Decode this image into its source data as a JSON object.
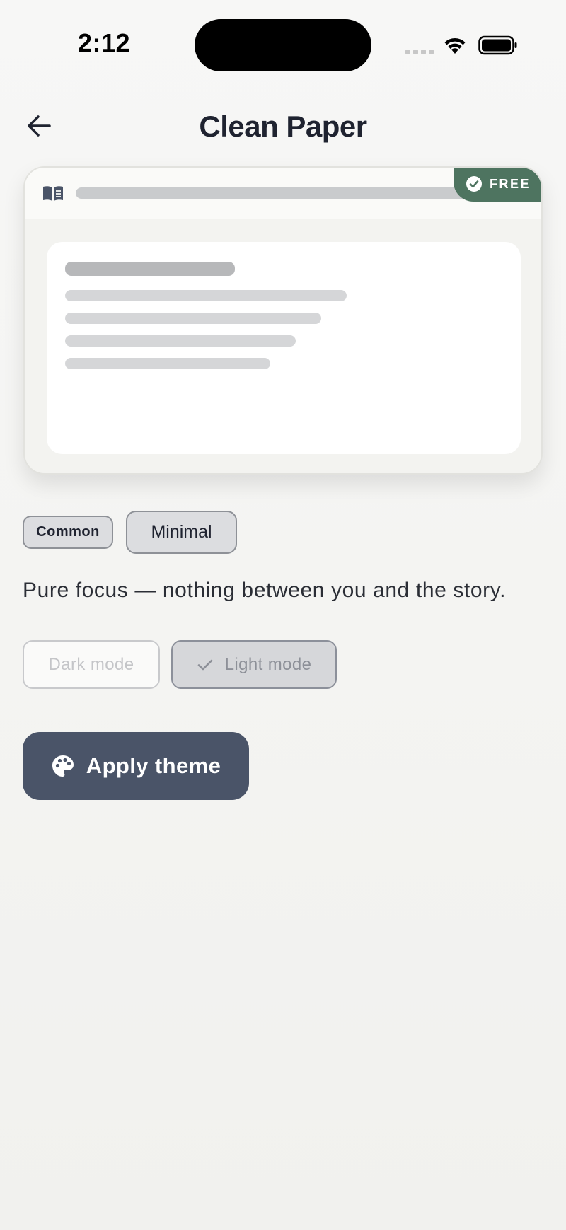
{
  "status_bar": {
    "time": "2:12",
    "icons": [
      "cellular-signal-icon",
      "wifi-icon",
      "battery-icon"
    ]
  },
  "header": {
    "title": "Clean Paper",
    "back_icon": "arrow-left-icon"
  },
  "preview": {
    "badge_label": "FREE",
    "badge_icon": "check-circle-icon",
    "reader_icon": "book-icon"
  },
  "tags": {
    "rarity": "Common",
    "style": "Minimal"
  },
  "description": "Pure focus — nothing between you and the story.",
  "modes": {
    "dark_label": "Dark mode",
    "light_label": "Light mode",
    "selected": "Light mode"
  },
  "apply": {
    "label": "Apply theme",
    "icon": "palette-icon"
  },
  "colors": {
    "accent": "#4a5468",
    "badge_green": "#4e7460",
    "background": "#f4f4f2"
  }
}
